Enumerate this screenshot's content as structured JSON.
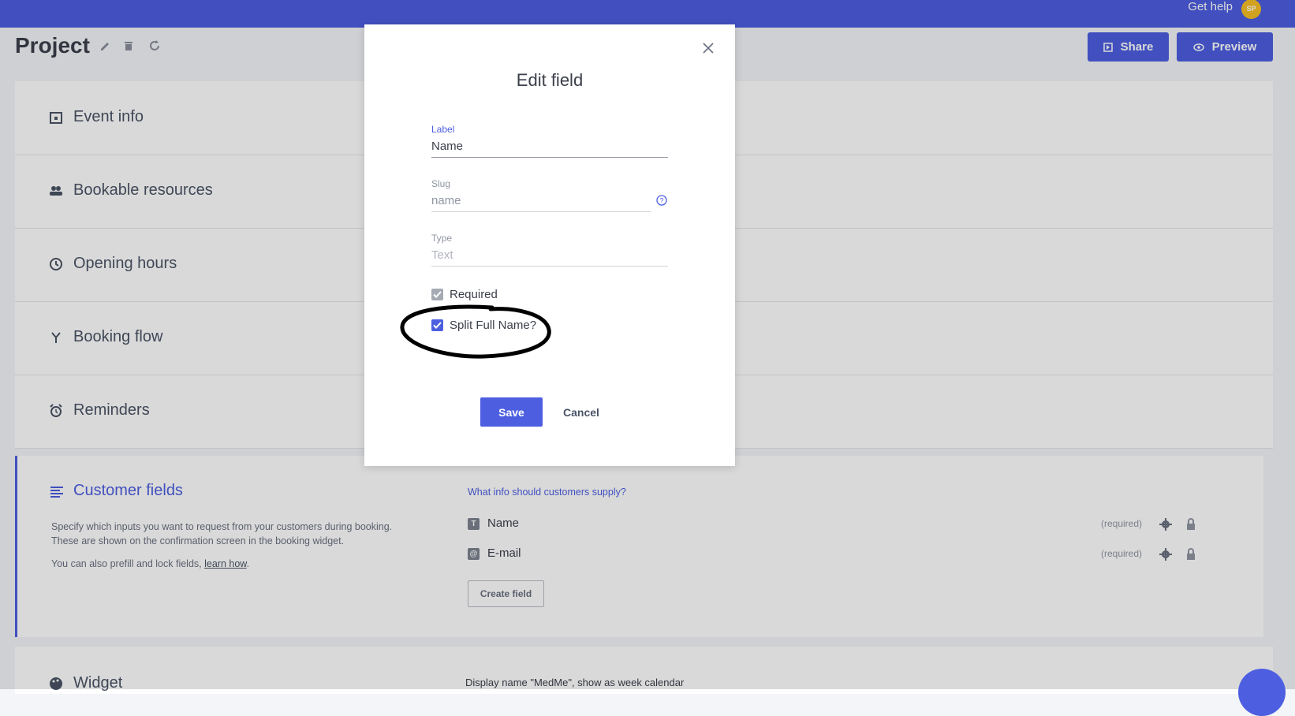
{
  "topbar": {
    "get_help": "Get help",
    "avatar_initials": "SP",
    "accent_color": "#4d5fe0"
  },
  "header": {
    "title": "Project",
    "icons": [
      "pencil-icon",
      "trash-icon",
      "refresh-icon"
    ],
    "share_label": "Share",
    "preview_label": "Preview"
  },
  "sections": [
    {
      "icon": "calendar-icon",
      "label": "Event info"
    },
    {
      "icon": "people-icon",
      "label": "Bookable resources"
    },
    {
      "icon": "clock-icon",
      "label": "Opening hours"
    },
    {
      "icon": "branch-icon",
      "label": "Booking flow"
    },
    {
      "icon": "alarm-icon",
      "label": "Reminders"
    }
  ],
  "customer_fields": {
    "title": "Customer fields",
    "description": "Specify which inputs you want to request from your customers during booking. These are shown on the confirmation screen in the booking widget.",
    "prefill_text": "You can also prefill and lock fields,",
    "prefill_link": "learn how",
    "prefill_end": ".",
    "question": "What info should customers supply?",
    "fields": [
      {
        "type_icon": "T",
        "label": "Name",
        "status": "(required)"
      },
      {
        "type_icon": "@",
        "label": "E-mail",
        "status": "(required)"
      }
    ],
    "create_button": "Create field"
  },
  "widget": {
    "title": "Widget",
    "description": "Display name \"MedMe\", show as week calendar"
  },
  "modal": {
    "title": "Edit field",
    "label_field": {
      "caption": "Label",
      "value": "Name"
    },
    "slug_field": {
      "caption": "Slug",
      "value": "name"
    },
    "type_field": {
      "caption": "Type",
      "value": "Text"
    },
    "required_label": "Required",
    "required_checked": true,
    "split_label": "Split Full Name?",
    "split_checked": true,
    "save_label": "Save",
    "cancel_label": "Cancel"
  }
}
